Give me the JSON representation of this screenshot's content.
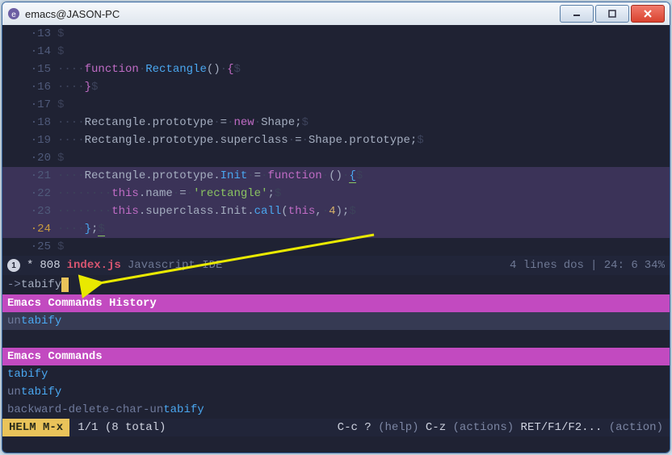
{
  "window": {
    "title": "emacs@JASON-PC"
  },
  "code": {
    "lines": [
      {
        "n": "13",
        "active": false,
        "hl": false,
        "segs": [
          {
            "t": "$",
            "c": "eol"
          }
        ]
      },
      {
        "n": "14",
        "active": false,
        "hl": false,
        "segs": [
          {
            "t": "$",
            "c": "eol"
          }
        ]
      },
      {
        "n": "15",
        "active": false,
        "hl": false,
        "segs": [
          {
            "t": "····",
            "c": "ws"
          },
          {
            "t": "function",
            "c": "kw"
          },
          {
            "t": "·",
            "c": "ws"
          },
          {
            "t": "Rectangle",
            "c": "fnname"
          },
          {
            "t": "()",
            "c": "op"
          },
          {
            "t": "·",
            "c": "ws"
          },
          {
            "t": "{",
            "c": "brace"
          },
          {
            "t": "$",
            "c": "eol"
          }
        ]
      },
      {
        "n": "16",
        "active": false,
        "hl": false,
        "segs": [
          {
            "t": "····",
            "c": "ws"
          },
          {
            "t": "}",
            "c": "brace"
          },
          {
            "t": "$",
            "c": "eol"
          }
        ]
      },
      {
        "n": "17",
        "active": false,
        "hl": false,
        "segs": [
          {
            "t": "$",
            "c": "eol"
          }
        ]
      },
      {
        "n": "18",
        "active": false,
        "hl": false,
        "segs": [
          {
            "t": "····",
            "c": "ws"
          },
          {
            "t": "Rectangle.prototype",
            "c": "cls"
          },
          {
            "t": "·",
            "c": "ws"
          },
          {
            "t": "=",
            "c": "op"
          },
          {
            "t": "·",
            "c": "ws"
          },
          {
            "t": "new",
            "c": "new"
          },
          {
            "t": "·",
            "c": "ws"
          },
          {
            "t": "Shape;",
            "c": "cls"
          },
          {
            "t": "$",
            "c": "eol"
          }
        ]
      },
      {
        "n": "19",
        "active": false,
        "hl": false,
        "segs": [
          {
            "t": "····",
            "c": "ws"
          },
          {
            "t": "Rectangle.prototype.superclass",
            "c": "cls"
          },
          {
            "t": "·",
            "c": "ws"
          },
          {
            "t": "=",
            "c": "op"
          },
          {
            "t": "·",
            "c": "ws"
          },
          {
            "t": "Shape.prototype;",
            "c": "cls"
          },
          {
            "t": "$",
            "c": "eol"
          }
        ]
      },
      {
        "n": "20",
        "active": false,
        "hl": false,
        "segs": [
          {
            "t": "$",
            "c": "eol"
          }
        ]
      },
      {
        "n": "21",
        "active": false,
        "hl": true,
        "segs": [
          {
            "t": "····",
            "c": "ws"
          },
          {
            "t": "Rectangle.prototype.",
            "c": "cls"
          },
          {
            "t": "Init",
            "c": "prop"
          },
          {
            "t": "·",
            "c": "ws"
          },
          {
            "t": "=",
            "c": "op"
          },
          {
            "t": "·",
            "c": "ws"
          },
          {
            "t": "function",
            "c": "kw"
          },
          {
            "t": "·",
            "c": "ws"
          },
          {
            "t": "()",
            "c": "op"
          },
          {
            "t": "·",
            "c": "ws"
          },
          {
            "t": "{",
            "c": "brace2 ul"
          },
          {
            "t": "$",
            "c": "eol"
          }
        ]
      },
      {
        "n": "22",
        "active": false,
        "hl": true,
        "segs": [
          {
            "t": "········",
            "c": "ws"
          },
          {
            "t": "this",
            "c": "this"
          },
          {
            "t": ".name",
            "c": "cls"
          },
          {
            "t": "·",
            "c": "ws"
          },
          {
            "t": "=",
            "c": "op"
          },
          {
            "t": "·",
            "c": "ws"
          },
          {
            "t": "'rectangle'",
            "c": "str"
          },
          {
            "t": ";",
            "c": "op"
          },
          {
            "t": "$",
            "c": "eol"
          }
        ]
      },
      {
        "n": "23",
        "active": false,
        "hl": true,
        "segs": [
          {
            "t": "········",
            "c": "ws"
          },
          {
            "t": "this",
            "c": "this"
          },
          {
            "t": ".superclass.Init.",
            "c": "cls"
          },
          {
            "t": "call",
            "c": "prop"
          },
          {
            "t": "(",
            "c": "op"
          },
          {
            "t": "this",
            "c": "this"
          },
          {
            "t": ",",
            "c": "op"
          },
          {
            "t": "·",
            "c": "ws"
          },
          {
            "t": "4",
            "c": "num"
          },
          {
            "t": ")",
            "c": "op"
          },
          {
            "t": ";",
            "c": "op"
          },
          {
            "t": "$",
            "c": "eol"
          }
        ]
      },
      {
        "n": "24",
        "active": true,
        "hl": true,
        "segs": [
          {
            "t": "····",
            "c": "ws"
          },
          {
            "t": "}",
            "c": "brace2"
          },
          {
            "t": ";",
            "c": "op"
          },
          {
            "t": "$",
            "c": "eol ul"
          }
        ]
      },
      {
        "n": "25",
        "active": false,
        "hl": false,
        "segs": [
          {
            "t": "$",
            "c": "eol"
          }
        ]
      }
    ]
  },
  "modeline": {
    "mod": "*",
    "linenum": "808",
    "filename": "index.js",
    "mode": "Javascript-IDE",
    "region": "4 lines",
    "eol": "dos",
    "pos": "| 24: 6",
    "pct": "34%"
  },
  "prompt": {
    "prefix": "->",
    "input": "tabify"
  },
  "helm": {
    "history_header": "Emacs Commands History",
    "history": [
      {
        "pre": "un",
        "match": "tabify",
        "post": ""
      }
    ],
    "commands_header": "Emacs Commands",
    "commands": [
      {
        "pre": "",
        "match": "tabify",
        "post": ""
      },
      {
        "pre": "un",
        "match": "tabify",
        "post": ""
      },
      {
        "pre": "backward-delete-char-un",
        "match": "tabify",
        "post": ""
      }
    ]
  },
  "bottombar": {
    "pill": "HELM M-x",
    "count": "1/1 (8 total)",
    "hints": [
      {
        "k": "C-c ?",
        "d": "(help)"
      },
      {
        "k": "C-z",
        "d": "(actions)"
      },
      {
        "k": "RET/F1/F2...",
        "d": "(action)"
      }
    ]
  }
}
